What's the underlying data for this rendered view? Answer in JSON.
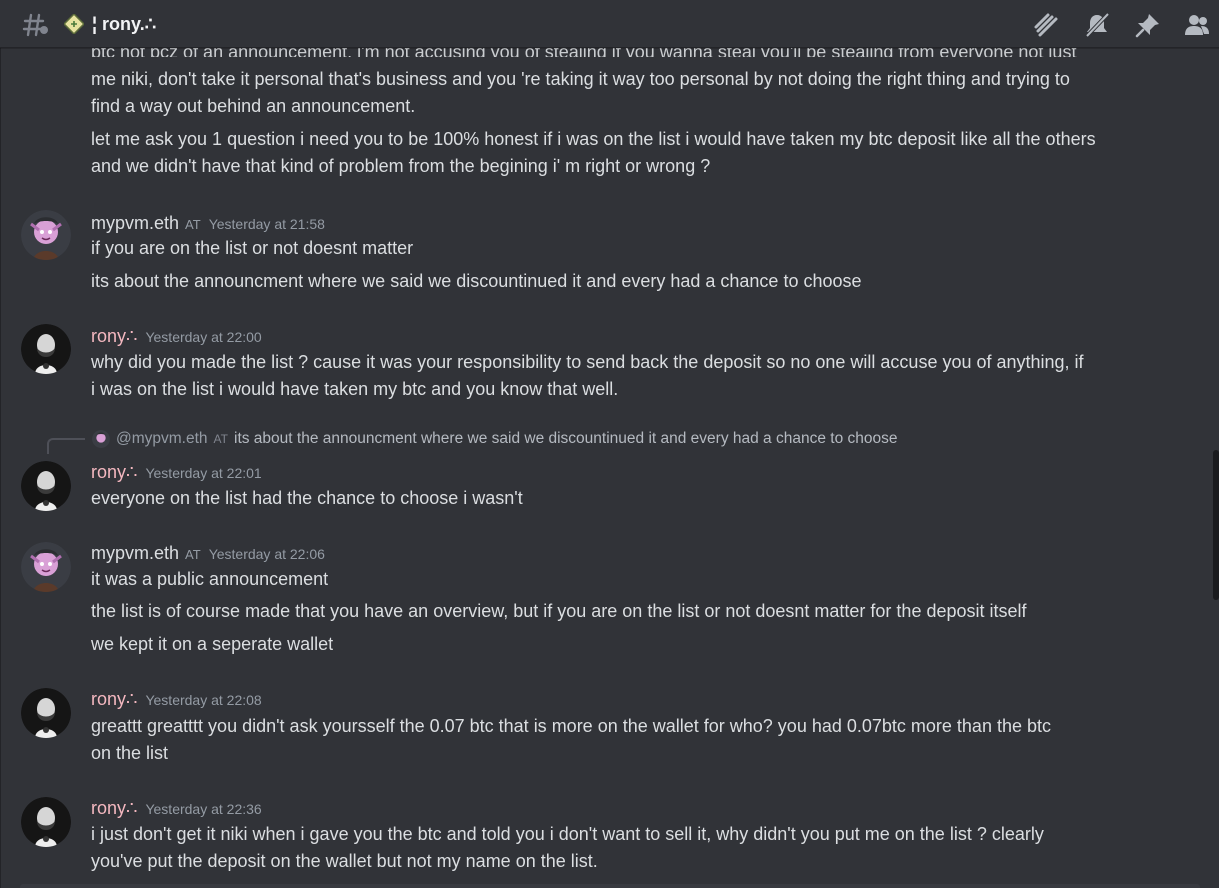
{
  "header": {
    "channel_name": "¦ rony.∴",
    "icons": [
      "threads-icon",
      "channel-emoji-icon",
      "threads-list-icon",
      "mute-bell-icon",
      "pin-icon",
      "member-list-icon"
    ]
  },
  "messages": {
    "cont_top_clipped": "btc not bcz of an announcement, i'm not accusing you of stealing if you wanna steal you'll be stealing from everyone not just",
    "cont1_line2": "me niki, don't take it personal that's business and you 're taking it way too personal by not doing the right thing and trying to",
    "cont1_line3": "find a way out behind an announcement.",
    "cont2_line1": "let me ask you 1 question i need you to be 100% honest if i was on the list i would have taken my btc deposit like all the others",
    "cont2_line2": "and we didn't have that kind of problem from the begining i' m right or wrong ?",
    "g1": {
      "user": "mypvm.eth",
      "tag": "AT",
      "time": "Yesterday at 21:58",
      "lines": [
        "if you are on the list or not doesnt matter",
        "its about the announcment where we said we discountinued it and every had a chance to choose"
      ]
    },
    "g2": {
      "user": "rony∴",
      "time": "Yesterday at 22:00",
      "line1": "why did you made the list ? cause it was your responsibility to send back the deposit so no one will accuse you of anything, if",
      "line2": "i was on the list i would have taken my btc and you know that well."
    },
    "reply": {
      "user": "@mypvm.eth",
      "tag": "AT",
      "text": "its about the announcment where we said we discountinued it and every had a chance to choose"
    },
    "g3": {
      "user": "rony∴",
      "time": "Yesterday at 22:01",
      "line1": "everyone on the list had the chance to choose i wasn't"
    },
    "g4": {
      "user": "mypvm.eth",
      "tag": "AT",
      "time": "Yesterday at 22:06",
      "lines": [
        "it was a public announcement",
        "the list is of course made that you have an overview, but if you are on the list or not doesnt matter for the deposit itself",
        "we kept it on a seperate wallet"
      ]
    },
    "g5": {
      "user": "rony∴",
      "time": "Yesterday at 22:08",
      "line1": "greattt greatttt you didn't ask yoursself the 0.07 btc that is more on the wallet for who? you had 0.07btc more than the btc",
      "line2": "on the list"
    },
    "g6": {
      "user": "rony∴",
      "time": "Yesterday at 22:36",
      "line1": "i just don't get it niki when i gave you the btc and told you i don't want to sell it, why didn't you put me on the list ? clearly",
      "line2": "you've put the deposit on the wallet but not my name on the list."
    }
  }
}
